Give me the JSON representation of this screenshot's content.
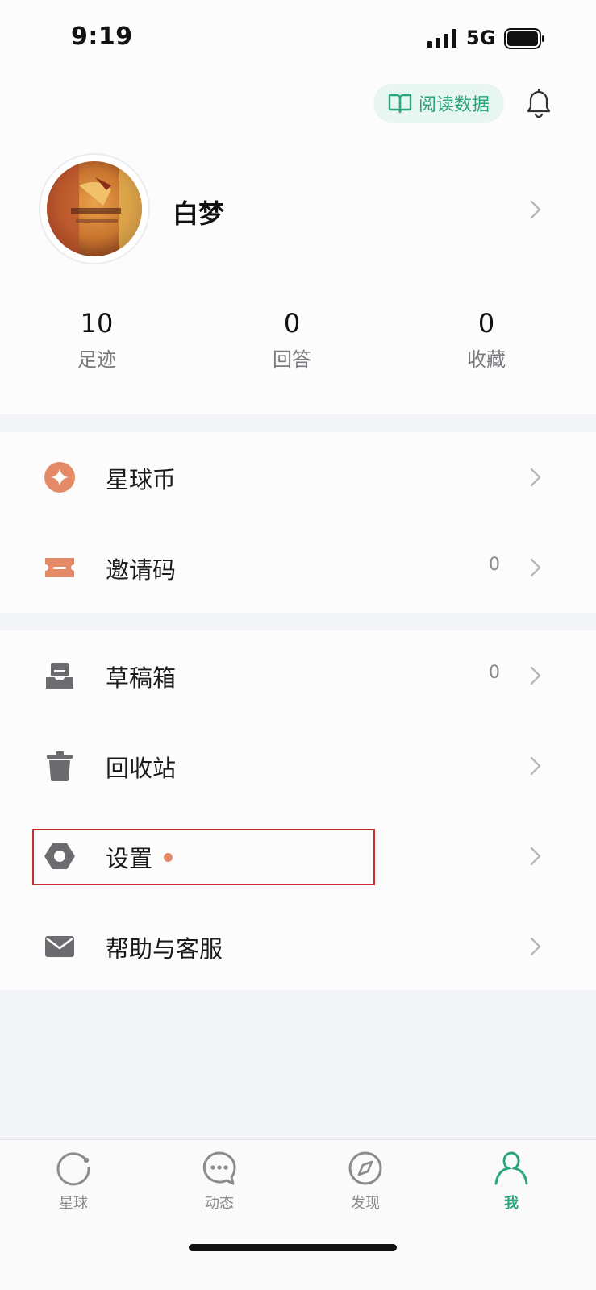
{
  "status_bar": {
    "time": "9:19",
    "network": "5G"
  },
  "header": {
    "read_data_label": "阅读数据"
  },
  "profile": {
    "name": "白梦"
  },
  "stats": [
    {
      "value": "10",
      "label": "足迹"
    },
    {
      "value": "0",
      "label": "回答"
    },
    {
      "value": "0",
      "label": "收藏"
    }
  ],
  "menu_group_1": [
    {
      "label": "星球币",
      "icon": "star-coin-icon"
    },
    {
      "label": "邀请码",
      "icon": "ticket-icon",
      "count": "0"
    }
  ],
  "menu_group_2": [
    {
      "label": "草稿箱",
      "icon": "drafts-tray-icon",
      "count": "0"
    },
    {
      "label": "回收站",
      "icon": "trash-icon"
    },
    {
      "label": "设置",
      "icon": "settings-hex-icon"
    },
    {
      "label": "帮助与客服",
      "icon": "mail-icon"
    }
  ],
  "tabbar": [
    {
      "label": "星球",
      "icon": "planet-icon"
    },
    {
      "label": "动态",
      "icon": "chat-bubble-icon"
    },
    {
      "label": "发现",
      "icon": "compass-icon"
    },
    {
      "label": "我",
      "icon": "person-icon",
      "active": true
    }
  ],
  "colors": {
    "accent_green": "#2aa57c",
    "accent_orange": "#e58a67",
    "icon_gray": "#6c6c70",
    "highlight_red": "#cc2b2b"
  }
}
